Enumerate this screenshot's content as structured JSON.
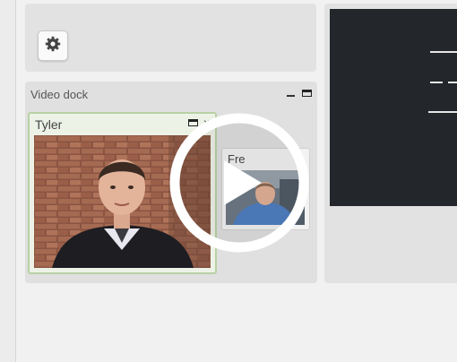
{
  "settings": {
    "icon": "gear-icon"
  },
  "video_dock": {
    "title": "Video dock",
    "tiles": [
      {
        "name": "Tyler"
      },
      {
        "name": "Fre"
      }
    ]
  },
  "overlay": {
    "icon": "play-icon"
  },
  "colors": {
    "tile_active_border": "#b8d1a4",
    "blackboard": "#23272c",
    "panel": "#e0e0e0"
  }
}
